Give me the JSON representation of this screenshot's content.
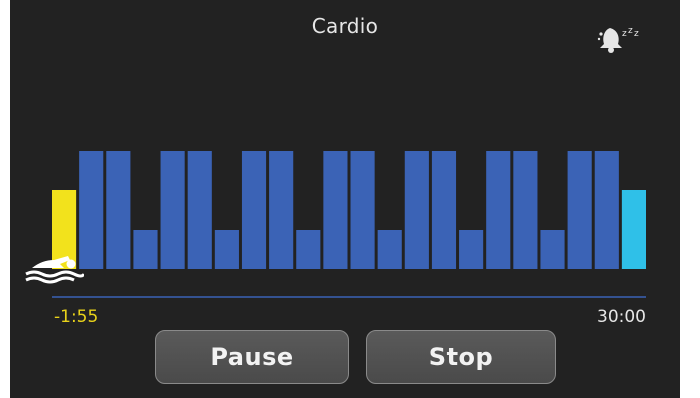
{
  "header": {
    "title": "Cardio",
    "sleep_icon": "sleep-mode-icon"
  },
  "workout": {
    "activity_icon": "swimmer-icon",
    "elapsed_label": "-1:55",
    "total_label": "30:00",
    "colors": {
      "warmup": "#f2e21c",
      "interval": "#3b63b6",
      "cooldown": "#2fc0e8",
      "timeline": "#3b63b6",
      "elapsed_text": "#e8d21a"
    },
    "segments": [
      {
        "phase": "warmup",
        "level": 2
      },
      {
        "phase": "interval",
        "level": 3
      },
      {
        "phase": "interval",
        "level": 3
      },
      {
        "phase": "interval",
        "level": 1
      },
      {
        "phase": "interval",
        "level": 3
      },
      {
        "phase": "interval",
        "level": 3
      },
      {
        "phase": "interval",
        "level": 1
      },
      {
        "phase": "interval",
        "level": 3
      },
      {
        "phase": "interval",
        "level": 3
      },
      {
        "phase": "interval",
        "level": 1
      },
      {
        "phase": "interval",
        "level": 3
      },
      {
        "phase": "interval",
        "level": 3
      },
      {
        "phase": "interval",
        "level": 1
      },
      {
        "phase": "interval",
        "level": 3
      },
      {
        "phase": "interval",
        "level": 3
      },
      {
        "phase": "interval",
        "level": 1
      },
      {
        "phase": "interval",
        "level": 3
      },
      {
        "phase": "interval",
        "level": 3
      },
      {
        "phase": "interval",
        "level": 1
      },
      {
        "phase": "interval",
        "level": 3
      },
      {
        "phase": "interval",
        "level": 3
      },
      {
        "phase": "cooldown",
        "level": 2
      }
    ]
  },
  "controls": {
    "pause_label": "Pause",
    "stop_label": "Stop"
  }
}
